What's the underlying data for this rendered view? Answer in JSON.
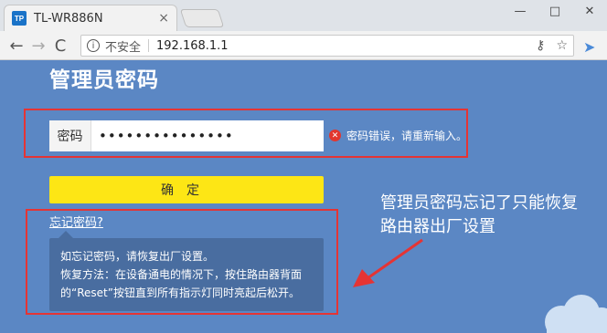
{
  "browser": {
    "tab_logo": "TP",
    "tab_title": "TL-WR886N",
    "tab_close": "×",
    "security_label": "不安全",
    "url": "192.168.1.1",
    "back_icon": "←",
    "forward_icon": "→",
    "reload_icon": "C",
    "key_icon": "⚷",
    "star_icon": "☆",
    "ext_icon": "➤",
    "win_min": "—",
    "win_max": "□",
    "win_close": "✕"
  },
  "page": {
    "title": "管理员密码",
    "password_label": "密码",
    "password_value": "•••••••••••••••",
    "error_text": "密码错误，请重新输入。",
    "confirm_button": "确定",
    "forgot_link": "忘记密码?",
    "tooltip_line1": "如忘记密码，请恢复出厂设置。",
    "tooltip_line2": "恢复方法：在设备通电的情况下，按住路由器背面",
    "tooltip_line3": "的“Reset”按钮直到所有指示灯同时亮起后松开。"
  },
  "annotation": {
    "line1": "管理员密码忘记了只能恢复",
    "line2": "路由器出厂设置"
  },
  "colors": {
    "background": "#5b87c4",
    "confirm_button": "#fde615",
    "highlight_box": "#e53434",
    "error_icon": "#e2362e"
  }
}
